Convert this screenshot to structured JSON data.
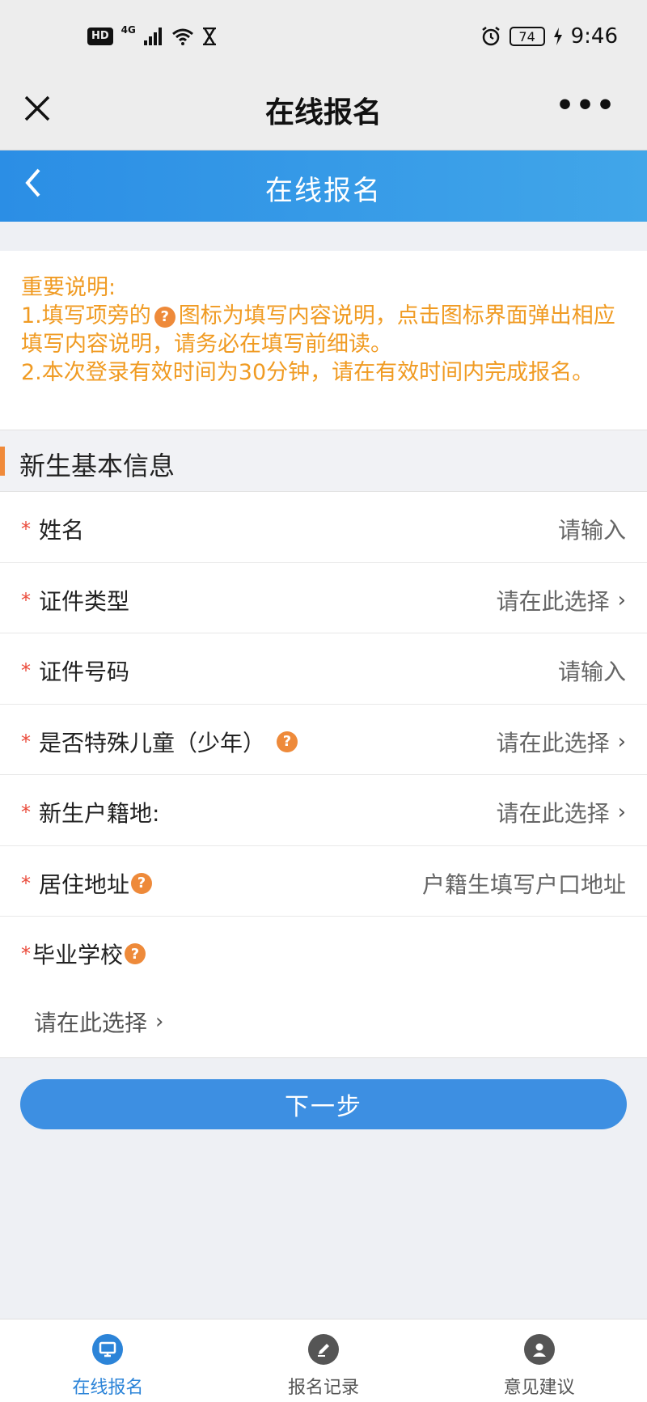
{
  "status_bar": {
    "hd": "HD",
    "network": "4G",
    "battery": "74",
    "time": "9:46"
  },
  "wechat_header": {
    "title": "在线报名",
    "more": "•••"
  },
  "app_header": {
    "title": "在线报名"
  },
  "notice": {
    "heading": "重要说明:",
    "line1_before": "1.填写项旁的",
    "line1_after": "图标为填写内容说明，点击图标界面弹出相应填写内容说明，请务必在填写前细读。",
    "line2": "2.本次登录有效时间为30分钟，请在有效时间内完成报名。",
    "icon_glyph": "?"
  },
  "section": {
    "title": "新生基本信息"
  },
  "form": {
    "required_mark": "*",
    "chevron": "›",
    "fields": [
      {
        "label": "姓名",
        "value": "请输入"
      },
      {
        "label": "证件类型",
        "value": "请在此选择"
      },
      {
        "label": "证件号码",
        "value": "请输入"
      },
      {
        "label": "是否特殊儿童（少年）",
        "value": "请在此选择"
      },
      {
        "label": "新生户籍地:",
        "value": "请在此选择"
      },
      {
        "label": "居住地址",
        "value": "户籍生填写户口地址"
      },
      {
        "label": "毕业学校",
        "value": "请在此选择"
      }
    ]
  },
  "next_button": {
    "label": "下一步"
  },
  "bottom_nav": {
    "items": [
      {
        "label": "在线报名",
        "icon": "monitor-icon",
        "active": true
      },
      {
        "label": "报名记录",
        "icon": "pencil-icon",
        "active": false
      },
      {
        "label": "意见建议",
        "icon": "user-icon",
        "active": false
      }
    ]
  },
  "colors": {
    "primary": "#3d8fe2",
    "notice": "#f09b23",
    "required": "#ea4a3a",
    "accent": "#f08a3a"
  }
}
